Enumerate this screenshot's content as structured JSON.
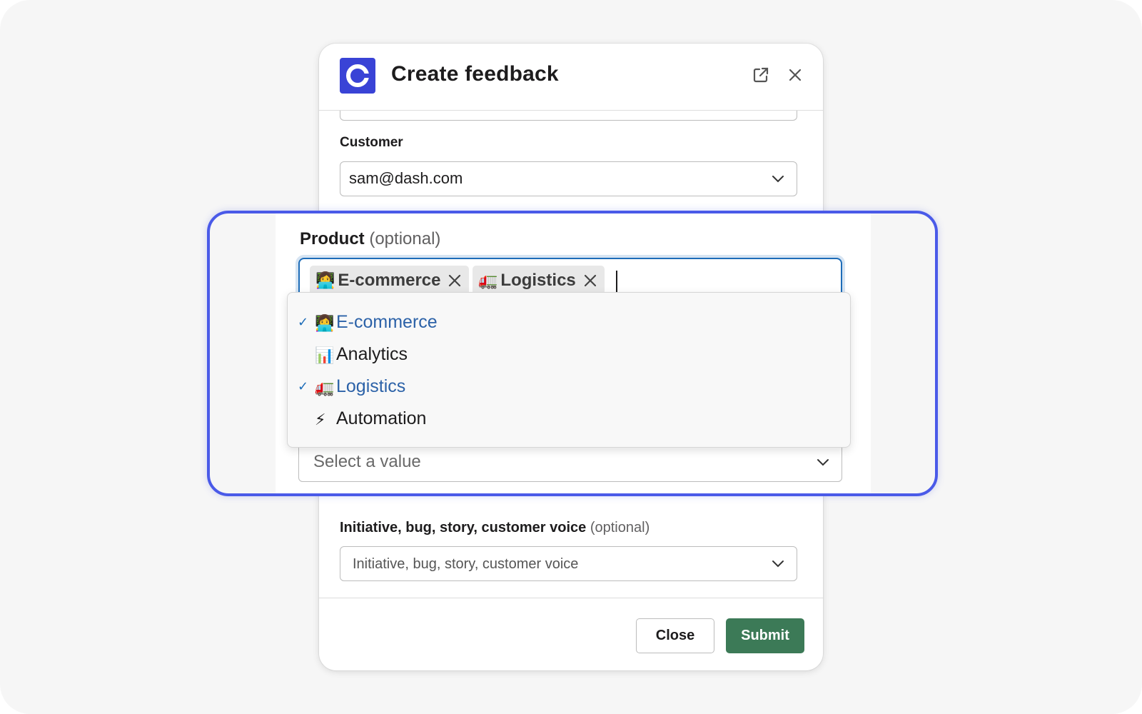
{
  "modal": {
    "title": "Create feedback",
    "fields": {
      "customer": {
        "label": "Customer",
        "value": "sam@dash.com"
      },
      "product": {
        "label": "Product",
        "optional": "(optional)"
      },
      "initiative": {
        "label": "Initiative, bug, story, customer voice",
        "optional": "(optional)",
        "placeholder": "Initiative, bug, story, customer voice"
      }
    },
    "footer": {
      "close_label": "Close",
      "submit_label": "Submit"
    }
  },
  "zoom": {
    "product_label": "Product",
    "product_optional": "(optional)",
    "chips": [
      {
        "emoji": "👩‍💻",
        "label": "E-commerce"
      },
      {
        "emoji": "🚛",
        "label": "Logistics"
      }
    ],
    "dropdown": [
      {
        "emoji": "👩‍💻",
        "label": "E-commerce",
        "selected": true
      },
      {
        "emoji": "📊",
        "label": "Analytics",
        "selected": false
      },
      {
        "emoji": "🚛",
        "label": "Logistics",
        "selected": true
      },
      {
        "emoji": "⚡",
        "label": "Automation",
        "selected": false
      }
    ],
    "select_placeholder": "Select a value"
  },
  "colors": {
    "accent_blue": "#4a5ae8",
    "logo_bg": "#3943d6",
    "submit_bg": "#3c7a57",
    "selected_text": "#2c62a8"
  }
}
